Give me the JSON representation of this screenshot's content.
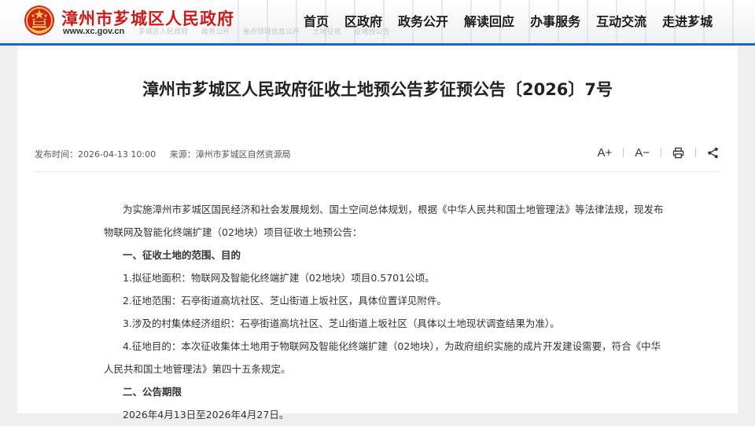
{
  "header": {
    "site_title": "漳州市芗城区人民政府",
    "domain": "www.xc.gov.cn",
    "breadcrumbs": [
      "芗城区人民政府",
      "政务公开",
      "重点领域信息公开",
      "土地征收",
      "征地预公告"
    ],
    "nav": [
      "首页",
      "区政府",
      "政务公开",
      "解读回应",
      "办事服务",
      "互动交流",
      "走进芗城"
    ]
  },
  "article": {
    "title": "漳州市芗城区人民政府征收土地预公告芗征预公告〔2026〕7号",
    "publish_time": "发布时间：2026-04-13 10:00",
    "source": "来源：漳州市芗城区自然资源局",
    "tools": {
      "font_increase": "A+",
      "font_decrease": "A−"
    },
    "intro": "为实施漳州市芗城区国民经济和社会发展规划、国土空间总体规划，根据《中华人民共和国土地管理法》等法律法规，现发布物联网及智能化终端扩建（02地块）项目征收土地预公告：",
    "section1_heading": "一、征收土地的范围、目的",
    "item1": "1.拟征地面积：物联网及智能化终端扩建（02地块）项目0.5701公顷。",
    "item2": "2.征地范围：石亭街道高坑社区、芝山街道上坂社区，具体位置详见附件。",
    "item3": "3.涉及的村集体经济组织：石亭街道高坑社区、芝山街道上坂社区（具体以土地现状调查结果为准）。",
    "item4": "4.征地目的：本次征收集体土地用于物联网及智能化终端扩建（02地块），为政府组织实施的成片开发建设需要，符合《中华人民共和国土地管理法》第四十五条规定。",
    "section2_heading": "二、公告期限",
    "period": "2026年4月13日至2026年4月27日。"
  },
  "colors": {
    "brand_red": "#cc1a1a",
    "accent_blue": "#1b67c7"
  },
  "icons": [
    "national-emblem-icon",
    "print-icon",
    "share-icon"
  ]
}
